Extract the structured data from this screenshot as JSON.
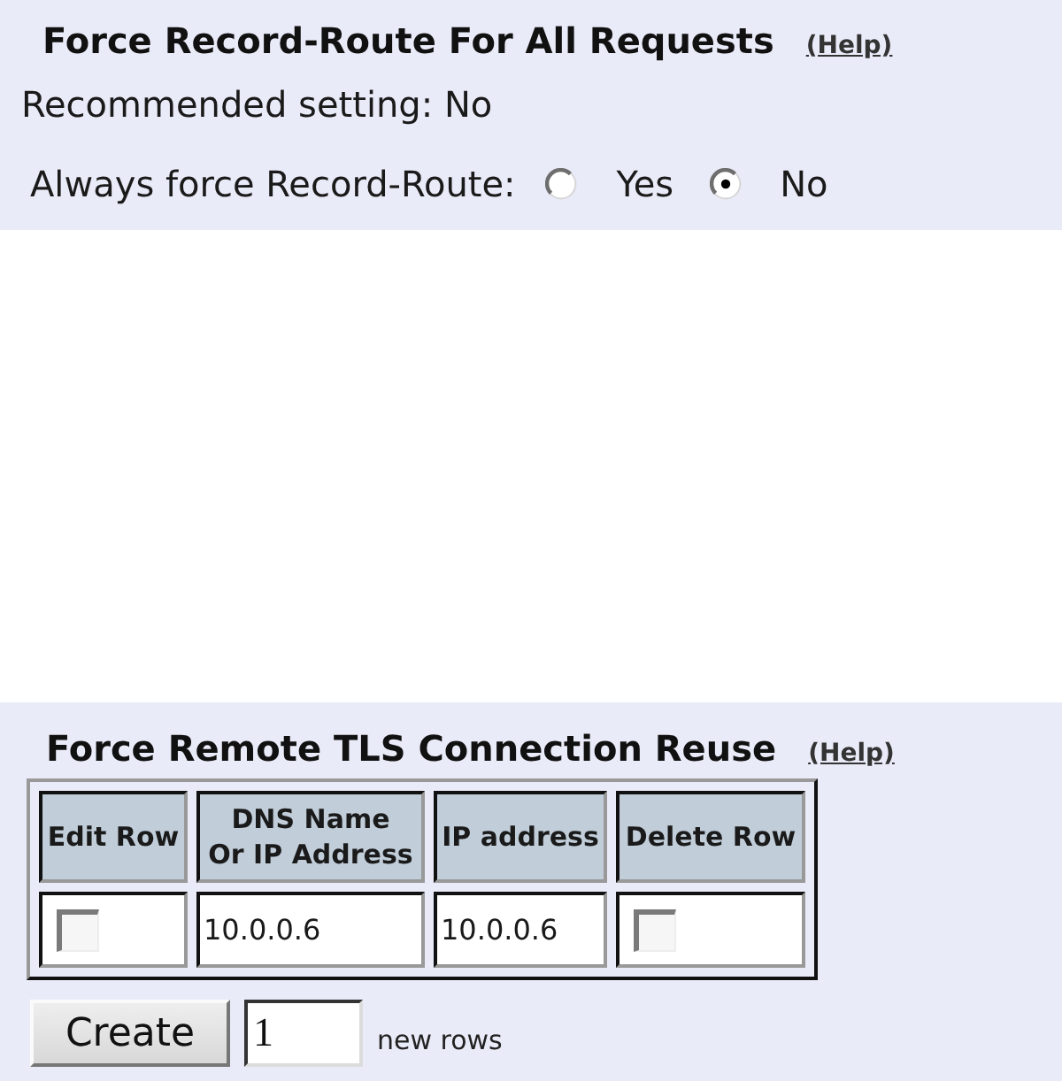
{
  "sections": [
    {
      "kind": "radio_setting",
      "title": "Force Record-Route For All Requests",
      "help": "(Help)",
      "recommended": "Recommended setting: No",
      "setting": {
        "label": "Always force Record-Route:",
        "options": [
          {
            "label": "Yes",
            "selected": false
          },
          {
            "label": "No",
            "selected": true
          }
        ]
      }
    },
    {
      "kind": "table_setting",
      "title": "Force Remote TLS Connection Reuse",
      "help": "(Help)",
      "table": {
        "columns": [
          "Edit Row",
          "DNS Name\nOr IP Address",
          "IP address",
          "Delete Row"
        ],
        "rows": [
          {
            "cells": [
              {
                "kind": "checkbox",
                "checked": false
              },
              {
                "kind": "text",
                "text": "10.0.0.6"
              },
              {
                "kind": "text",
                "text": "10.0.0.6"
              },
              {
                "kind": "checkbox",
                "checked": false
              }
            ]
          }
        ]
      },
      "create": {
        "button": "Create",
        "count": "1",
        "suffix": "new rows"
      }
    }
  ]
}
